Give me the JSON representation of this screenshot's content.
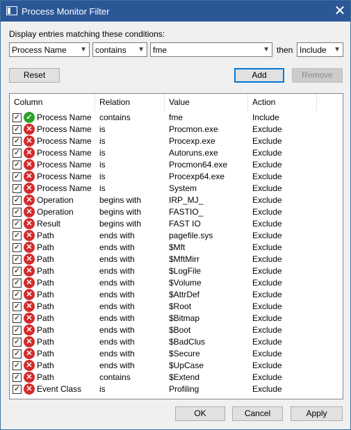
{
  "window": {
    "title": "Process Monitor Filter",
    "close_glyph": "✕"
  },
  "prompt": "Display entries matching these conditions:",
  "condition": {
    "column": "Process Name",
    "relation": "contains",
    "value": "fme",
    "then_label": "then",
    "action": "Include"
  },
  "buttons": {
    "reset": "Reset",
    "add": "Add",
    "remove": "Remove",
    "ok": "OK",
    "cancel": "Cancel",
    "apply": "Apply"
  },
  "columns": [
    "Column",
    "Relation",
    "Value",
    "Action"
  ],
  "colors": {
    "include_icon": "#2aa12a",
    "exclude_icon": "#d42b2b",
    "titlebar": "#2b5797"
  },
  "rows": [
    {
      "column": "Process Name",
      "relation": "contains",
      "value": "fme",
      "action": "Include",
      "icon": "check-icon"
    },
    {
      "column": "Process Name",
      "relation": "is",
      "value": "Procmon.exe",
      "action": "Exclude",
      "icon": "x-icon"
    },
    {
      "column": "Process Name",
      "relation": "is",
      "value": "Procexp.exe",
      "action": "Exclude",
      "icon": "x-icon"
    },
    {
      "column": "Process Name",
      "relation": "is",
      "value": "Autoruns.exe",
      "action": "Exclude",
      "icon": "x-icon"
    },
    {
      "column": "Process Name",
      "relation": "is",
      "value": "Procmon64.exe",
      "action": "Exclude",
      "icon": "x-icon"
    },
    {
      "column": "Process Name",
      "relation": "is",
      "value": "Procexp64.exe",
      "action": "Exclude",
      "icon": "x-icon"
    },
    {
      "column": "Process Name",
      "relation": "is",
      "value": "System",
      "action": "Exclude",
      "icon": "x-icon"
    },
    {
      "column": "Operation",
      "relation": "begins with",
      "value": "IRP_MJ_",
      "action": "Exclude",
      "icon": "x-icon"
    },
    {
      "column": "Operation",
      "relation": "begins with",
      "value": "FASTIO_",
      "action": "Exclude",
      "icon": "x-icon"
    },
    {
      "column": "Result",
      "relation": "begins with",
      "value": "FAST IO",
      "action": "Exclude",
      "icon": "x-icon"
    },
    {
      "column": "Path",
      "relation": "ends with",
      "value": "pagefile.sys",
      "action": "Exclude",
      "icon": "x-icon"
    },
    {
      "column": "Path",
      "relation": "ends with",
      "value": "$Mft",
      "action": "Exclude",
      "icon": "x-icon"
    },
    {
      "column": "Path",
      "relation": "ends with",
      "value": "$MftMirr",
      "action": "Exclude",
      "icon": "x-icon"
    },
    {
      "column": "Path",
      "relation": "ends with",
      "value": "$LogFile",
      "action": "Exclude",
      "icon": "x-icon"
    },
    {
      "column": "Path",
      "relation": "ends with",
      "value": "$Volume",
      "action": "Exclude",
      "icon": "x-icon"
    },
    {
      "column": "Path",
      "relation": "ends with",
      "value": "$AttrDef",
      "action": "Exclude",
      "icon": "x-icon"
    },
    {
      "column": "Path",
      "relation": "ends with",
      "value": "$Root",
      "action": "Exclude",
      "icon": "x-icon"
    },
    {
      "column": "Path",
      "relation": "ends with",
      "value": "$Bitmap",
      "action": "Exclude",
      "icon": "x-icon"
    },
    {
      "column": "Path",
      "relation": "ends with",
      "value": "$Boot",
      "action": "Exclude",
      "icon": "x-icon"
    },
    {
      "column": "Path",
      "relation": "ends with",
      "value": "$BadClus",
      "action": "Exclude",
      "icon": "x-icon"
    },
    {
      "column": "Path",
      "relation": "ends with",
      "value": "$Secure",
      "action": "Exclude",
      "icon": "x-icon"
    },
    {
      "column": "Path",
      "relation": "ends with",
      "value": "$UpCase",
      "action": "Exclude",
      "icon": "x-icon"
    },
    {
      "column": "Path",
      "relation": "contains",
      "value": "$Extend",
      "action": "Exclude",
      "icon": "x-icon"
    },
    {
      "column": "Event Class",
      "relation": "is",
      "value": "Profiling",
      "action": "Exclude",
      "icon": "x-icon"
    }
  ]
}
